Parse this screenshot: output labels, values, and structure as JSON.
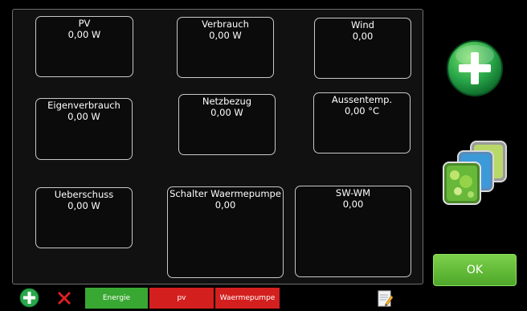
{
  "tiles": [
    {
      "name": "PV",
      "value": "0,00 W"
    },
    {
      "name": "Verbrauch",
      "value": "0,00 W"
    },
    {
      "name": "Wind",
      "value": "0,00"
    },
    {
      "name": "Eigenverbrauch",
      "value": "0,00 W"
    },
    {
      "name": "Netzbezug",
      "value": "0,00 W"
    },
    {
      "name": "Aussentemp.",
      "value": "0,00 °C"
    },
    {
      "name": "Ueberschuss",
      "value": "0,00 W"
    },
    {
      "name": "Schalter Waermepumpe",
      "value": "0,00"
    },
    {
      "name": "SW-WM",
      "value": "0,00"
    }
  ],
  "sidebar": {
    "add_icon": "plus-circle-icon",
    "gallery_icon": "image-gallery-icon",
    "ok_label": "OK"
  },
  "bottom_bar": {
    "add_icon": "plus-circle-icon",
    "delete_icon": "red-x-icon",
    "tabs": [
      {
        "label": "Energie",
        "color": "#39a832"
      },
      {
        "label": "pv",
        "color": "#d41f1f"
      },
      {
        "label": "Waermepumpe",
        "color": "#d41f1f"
      }
    ],
    "edit_icon": "notepad-pencil-icon"
  },
  "colors": {
    "background": "#000000",
    "ok_green": "#5cb936",
    "tab_active": "#39a832",
    "tab_inactive": "#d41f1f"
  }
}
